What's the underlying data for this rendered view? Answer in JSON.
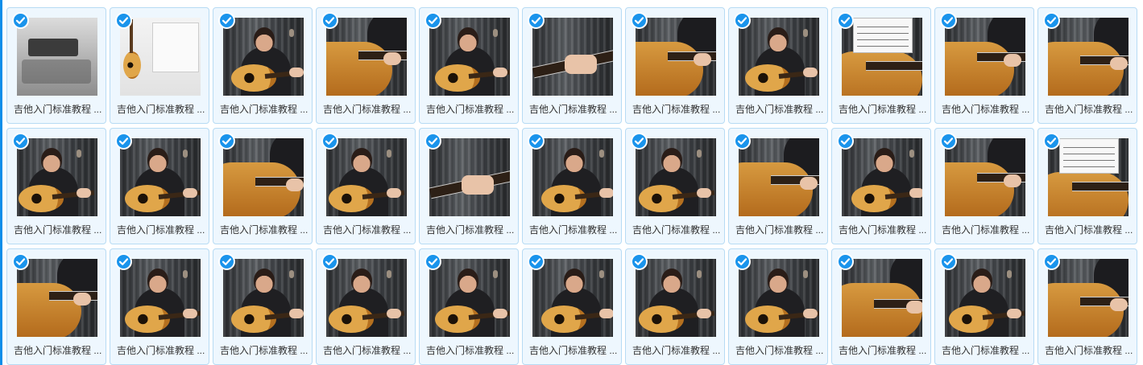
{
  "files": [
    {
      "label": "吉他入门标准教程 ...",
      "variant": "table",
      "selected": true
    },
    {
      "label": "吉他入门标准教程 ...",
      "variant": "white",
      "selected": true
    },
    {
      "label": "吉他入门标准教程 ...",
      "variant": "player",
      "selected": true
    },
    {
      "label": "吉他入门标准教程 ...",
      "variant": "closeup",
      "selected": true
    },
    {
      "label": "吉他入门标准教程 ...",
      "variant": "player",
      "selected": true
    },
    {
      "label": "吉他入门标准教程 ...",
      "variant": "hand",
      "selected": true
    },
    {
      "label": "吉他入门标准教程 ...",
      "variant": "closeup",
      "selected": true
    },
    {
      "label": "吉他入门标准教程 ...",
      "variant": "player",
      "selected": true
    },
    {
      "label": "吉他入门标准教程 ...",
      "variant": "sheet",
      "selected": true
    },
    {
      "label": "吉他入门标准教程 ...",
      "variant": "closeup",
      "selected": true
    },
    {
      "label": "吉他入门标准教程 ...",
      "variant": "closeup",
      "selected": true
    },
    {
      "label": "吉他入门标准教程 ...",
      "variant": "player",
      "selected": true
    },
    {
      "label": "吉他入门标准教程 ...",
      "variant": "player",
      "selected": true
    },
    {
      "label": "吉他入门标准教程 ...",
      "variant": "closeup",
      "selected": true
    },
    {
      "label": "吉他入门标准教程 ...",
      "variant": "player",
      "selected": true
    },
    {
      "label": "吉他入门标准教程 ...",
      "variant": "hand",
      "selected": true
    },
    {
      "label": "吉他入门标准教程 ...",
      "variant": "player",
      "selected": true
    },
    {
      "label": "吉他入门标准教程 ...",
      "variant": "player",
      "selected": true
    },
    {
      "label": "吉他入门标准教程 ...",
      "variant": "closeup",
      "selected": true
    },
    {
      "label": "吉他入门标准教程 ...",
      "variant": "player",
      "selected": true
    },
    {
      "label": "吉他入门标准教程 ...",
      "variant": "closeup",
      "selected": true
    },
    {
      "label": "吉他入门标准教程 ...",
      "variant": "sheet",
      "selected": true
    },
    {
      "label": "吉他入门标准教程 ...",
      "variant": "closeup",
      "selected": true
    },
    {
      "label": "吉他入门标准教程 ...",
      "variant": "player",
      "selected": true
    },
    {
      "label": "吉他入门标准教程 ...",
      "variant": "player",
      "selected": true
    },
    {
      "label": "吉他入门标准教程 ...",
      "variant": "player",
      "selected": true
    },
    {
      "label": "吉他入门标准教程 ...",
      "variant": "player",
      "selected": true
    },
    {
      "label": "吉他入门标准教程 ...",
      "variant": "player",
      "selected": true
    },
    {
      "label": "吉他入门标准教程 ...",
      "variant": "player",
      "selected": true
    },
    {
      "label": "吉他入门标准教程 ...",
      "variant": "player",
      "selected": true
    },
    {
      "label": "吉他入门标准教程 ...",
      "variant": "closeup",
      "selected": true
    },
    {
      "label": "吉他入门标准教程 ...",
      "variant": "player",
      "selected": true
    },
    {
      "label": "吉他入门标准教程 ...",
      "variant": "closeup",
      "selected": true
    }
  ],
  "colors": {
    "accent": "#1a94ec",
    "card_border": "#b7dbf4",
    "card_bg": "#eef7fe",
    "left_strip": "#0d8ee9"
  },
  "icons": {
    "check": "check-icon"
  }
}
